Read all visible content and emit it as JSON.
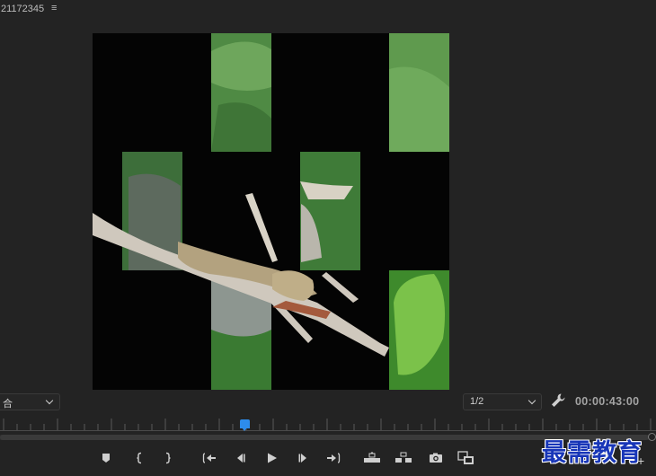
{
  "header": {
    "sequence_title": "21172345",
    "menu_icon": "hamburger-menu-icon"
  },
  "viewer": {
    "content": "puzzle-tile-video-frame",
    "colors": {
      "background": "#040404",
      "leaf": "#5f9a4e",
      "lizard": "#b3a27f"
    }
  },
  "fit_select": {
    "value": "合"
  },
  "resolution_select": {
    "value": "1/2"
  },
  "settings_icon": "wrench-icon",
  "timecode": "00:00:43:00",
  "playhead": {
    "position_fraction": 0.37,
    "color": "#2d8ceb"
  },
  "transport": {
    "buttons": [
      {
        "name": "add-marker-button",
        "icon": "marker-icon"
      },
      {
        "name": "mark-in-button",
        "icon": "mark-in-icon"
      },
      {
        "name": "mark-out-button",
        "icon": "mark-out-icon"
      },
      {
        "name": "go-to-in-button",
        "icon": "go-to-in-icon"
      },
      {
        "name": "step-back-button",
        "icon": "step-back-icon"
      },
      {
        "name": "play-button",
        "icon": "play-icon"
      },
      {
        "name": "step-forward-button",
        "icon": "step-forward-icon"
      },
      {
        "name": "go-to-out-button",
        "icon": "go-to-out-icon"
      },
      {
        "name": "lift-button",
        "icon": "lift-icon"
      },
      {
        "name": "extract-button",
        "icon": "extract-icon"
      },
      {
        "name": "export-frame-button",
        "icon": "camera-icon"
      },
      {
        "name": "compare-view-button",
        "icon": "compare-icon"
      }
    ]
  },
  "add_button": {
    "label": "+"
  },
  "watermark": {
    "text": "最需教育"
  }
}
